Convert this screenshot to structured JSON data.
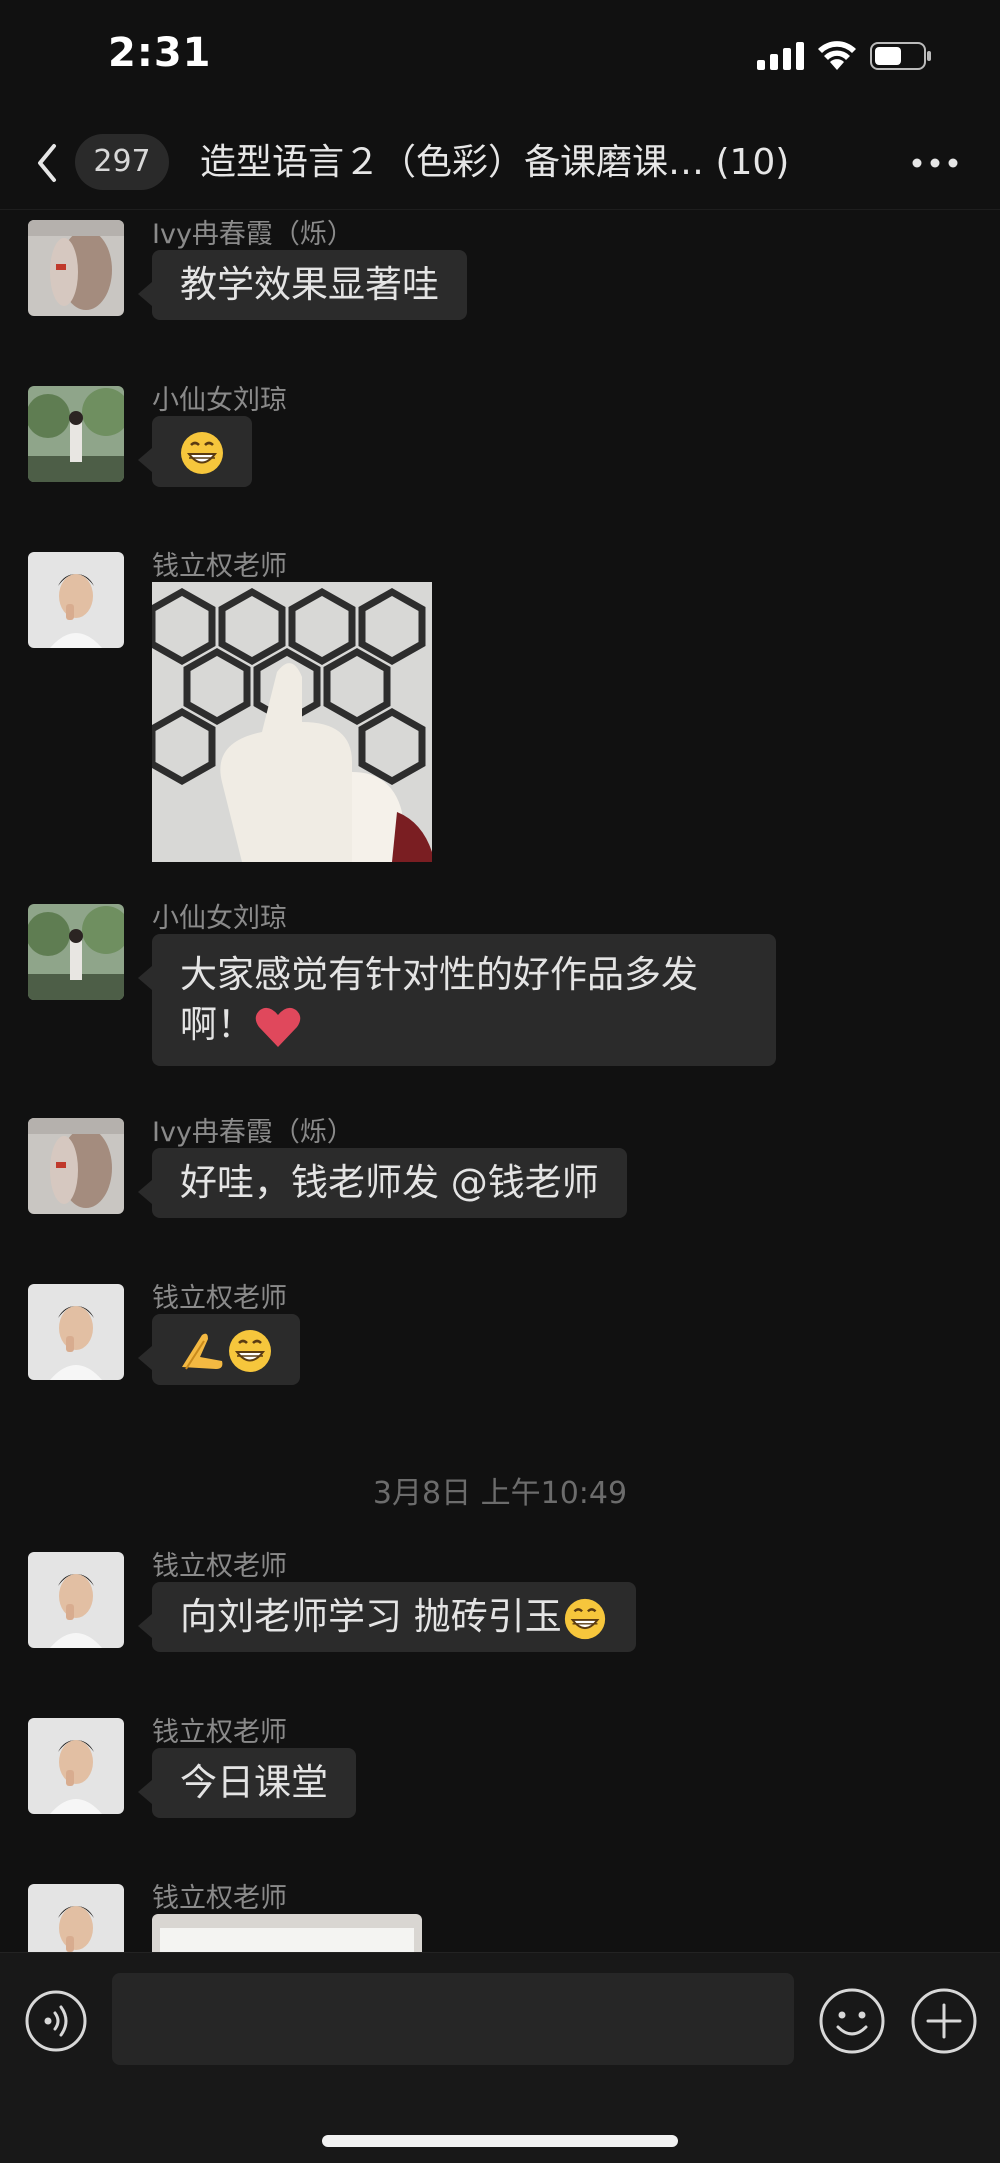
{
  "status_bar": {
    "time": "2:31"
  },
  "nav": {
    "unread_count": "297",
    "title": "造型语言２（色彩）备课磨课… (10)"
  },
  "messages": [
    {
      "sender": "Ivy冉春霞（烁）",
      "text": "教学效果显著哇",
      "avatar": "woman-profile-avatar"
    },
    {
      "sender": "小仙女刘琼",
      "text": "",
      "emoji": "grinning-face-emoji",
      "avatar": "girl-garden-avatar"
    },
    {
      "sender": "钱立权老师",
      "text": "",
      "image": "thumbs-up-hexagon-tile-photo",
      "avatar": "man-portrait-avatar"
    },
    {
      "sender": "小仙女刘琼",
      "text": "大家感觉有针对性的好作品多发啊！",
      "emoji": "red-heart-emoji",
      "avatar": "girl-garden-avatar"
    },
    {
      "sender": "Ivy冉春霞（烁）",
      "text": "好哇，钱老师发 @钱老师",
      "avatar": "woman-profile-avatar"
    },
    {
      "sender": "钱立权老师",
      "text": "",
      "emoji": "bowing-hands-grin-emoji",
      "avatar": "man-portrait-avatar"
    },
    {
      "sender": "钱立权老师",
      "text": "向刘老师学习 抛砖引玉",
      "emoji": "grinning-face-emoji",
      "avatar": "man-portrait-avatar"
    },
    {
      "sender": "钱立权老师",
      "text": "今日课堂",
      "avatar": "man-portrait-avatar"
    },
    {
      "sender": "钱立权老师",
      "text": "",
      "image": "partial-photo",
      "avatar": "man-portrait-avatar"
    }
  ],
  "timestamp": "3月8日 上午10:49",
  "input": {
    "placeholder": ""
  },
  "colors": {
    "background": "#111111",
    "bubble": "#2b2b2b",
    "sender_text": "#8a8a8a",
    "message_text": "#e4e4e4",
    "heart": "#e0485c",
    "emoji_yellow": "#f6c63c"
  }
}
